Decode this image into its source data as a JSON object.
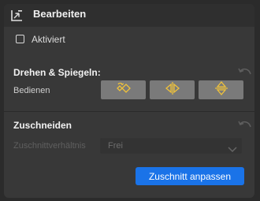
{
  "panel": {
    "title": "Bearbeiten",
    "collapse_icon": "collapse-corner-icon"
  },
  "enable": {
    "label": "Aktiviert",
    "checked": false
  },
  "rotate_flip": {
    "title": "Drehen & Spiegeln:",
    "row_label": "Bedienen",
    "reset_icon": "undo-arrow-icon",
    "buttons": [
      {
        "icon": "rotate-icon"
      },
      {
        "icon": "flip-horizontal-icon"
      },
      {
        "icon": "flip-vertical-icon"
      }
    ]
  },
  "crop": {
    "title": "Zuschneiden",
    "ratio_label": "Zuschnittverhältnis",
    "ratio_value": "Frei",
    "apply_label": "Zuschnitt anpassen",
    "reset_icon": "undo-arrow-icon"
  },
  "colors": {
    "accent": "#1a73e8",
    "icon_yellow": "#f0c23a",
    "button_gray": "#7a7a7a"
  }
}
